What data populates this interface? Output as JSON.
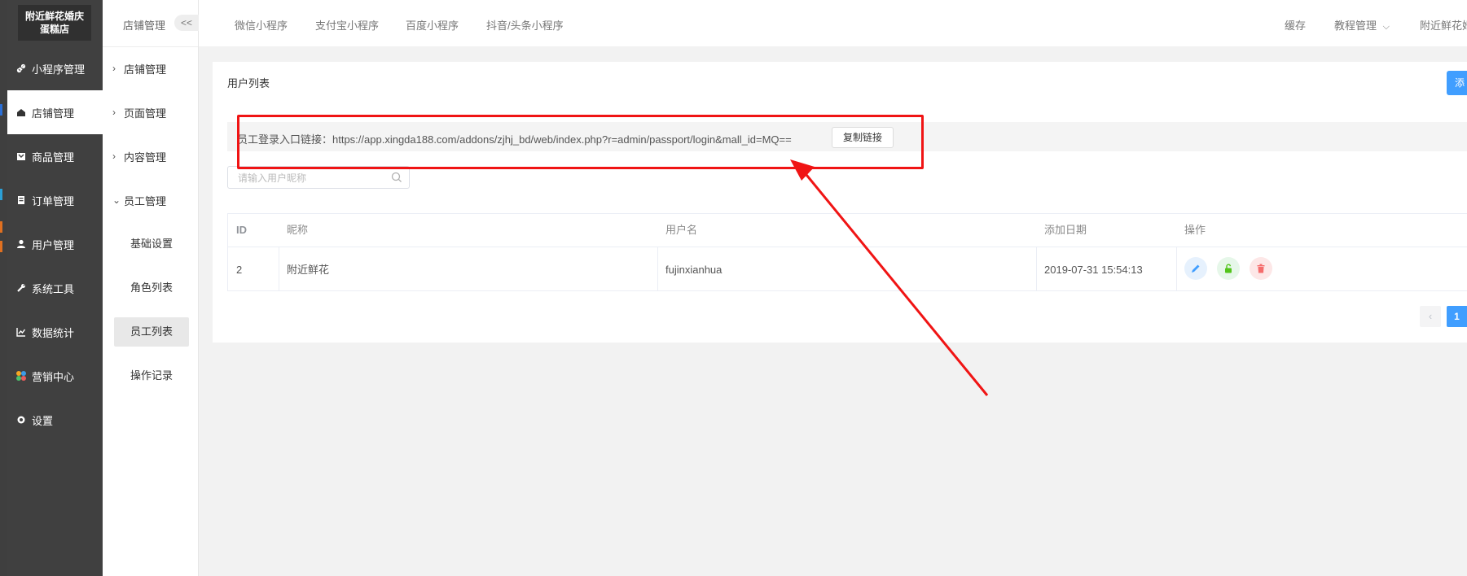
{
  "sidebar": {
    "logo_text": "附近鲜花婚庆\n蛋糕店",
    "items": [
      {
        "label": "小程序管理",
        "icon": "link-icon"
      },
      {
        "label": "店铺管理",
        "icon": "store-icon"
      },
      {
        "label": "商品管理",
        "icon": "goods-icon"
      },
      {
        "label": "订单管理",
        "icon": "order-icon"
      },
      {
        "label": "用户管理",
        "icon": "user-icon"
      },
      {
        "label": "系统工具",
        "icon": "wrench-icon"
      },
      {
        "label": "数据统计",
        "icon": "chart-icon"
      },
      {
        "label": "营销中心",
        "icon": "marketing-icon"
      },
      {
        "label": "设置",
        "icon": "gear-icon"
      }
    ]
  },
  "subnav": {
    "title": "店铺管理",
    "collapse": "<<",
    "groups": [
      {
        "label": "店铺管理"
      },
      {
        "label": "页面管理"
      },
      {
        "label": "内容管理"
      },
      {
        "label": "员工管理"
      }
    ],
    "children": [
      {
        "label": "基础设置"
      },
      {
        "label": "角色列表"
      },
      {
        "label": "员工列表"
      },
      {
        "label": "操作记录"
      }
    ]
  },
  "topbar": {
    "tabs": [
      "微信小程序",
      "支付宝小程序",
      "百度小程序",
      "抖音/头条小程序"
    ],
    "cache": "缓存",
    "tutorial": "教程管理",
    "user": "附近鲜花婚"
  },
  "page": {
    "title": "用户列表",
    "add_label": "添",
    "link_label": "员工登录入口链接：https://app.xingda188.com/addons/zjhj_bd/web/index.php?r=admin/passport/login&mall_id=MQ==",
    "copy_label": "复制链接",
    "search_placeholder": "请输入用户昵称"
  },
  "table": {
    "headers": [
      "ID",
      "昵称",
      "用户名",
      "添加日期",
      "操作"
    ],
    "rows": [
      {
        "id": "2",
        "nickname": "附近鲜花",
        "username": "fujinxianhua",
        "date": "2019-07-31 15:54:13"
      }
    ]
  },
  "pagination": {
    "prev": "‹",
    "current": "1"
  },
  "colors": {
    "primary": "#409eff",
    "sidebar": "#404040",
    "highlight": "#f01414"
  }
}
